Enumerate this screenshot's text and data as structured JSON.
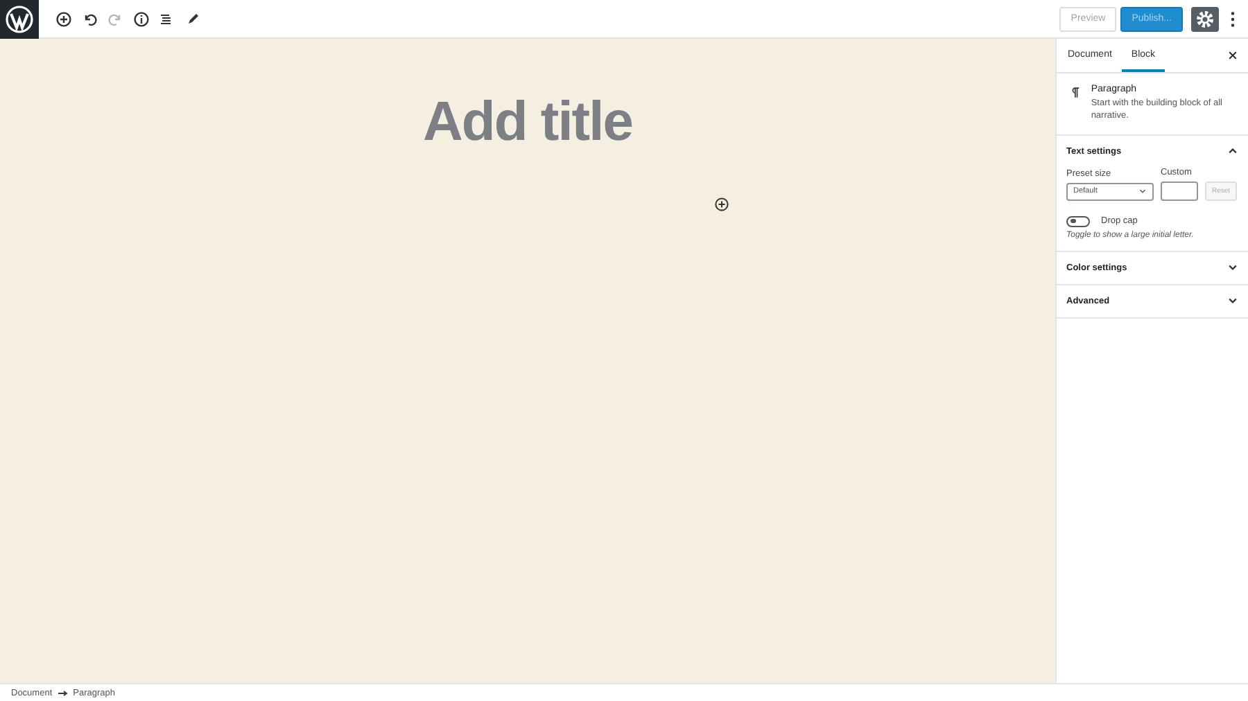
{
  "toolbar": {
    "redo_disabled": true
  },
  "header_actions": {
    "preview": "Preview",
    "publish": "Publish...",
    "settings_selected": true
  },
  "editor": {
    "title_placeholder": "Add title"
  },
  "sidebar": {
    "tabs": [
      {
        "label": "Document",
        "selected": false
      },
      {
        "label": "Block",
        "selected": true
      }
    ],
    "block": {
      "name": "Paragraph",
      "description": "Start with the building block of all narrative."
    },
    "panels": [
      {
        "title": "Text settings",
        "expanded": true
      },
      {
        "title": "Color settings",
        "expanded": false
      },
      {
        "title": "Advanced",
        "expanded": false
      }
    ],
    "text_settings": {
      "preset_label": "Preset size",
      "preset_value": "Default",
      "custom_label": "Custom",
      "reset": "Reset",
      "drop_cap_label": "Drop cap",
      "drop_cap_on": false,
      "drop_cap_help": "Toggle to show a large initial letter."
    }
  },
  "breadcrumb": [
    "Document",
    "Paragraph"
  ]
}
